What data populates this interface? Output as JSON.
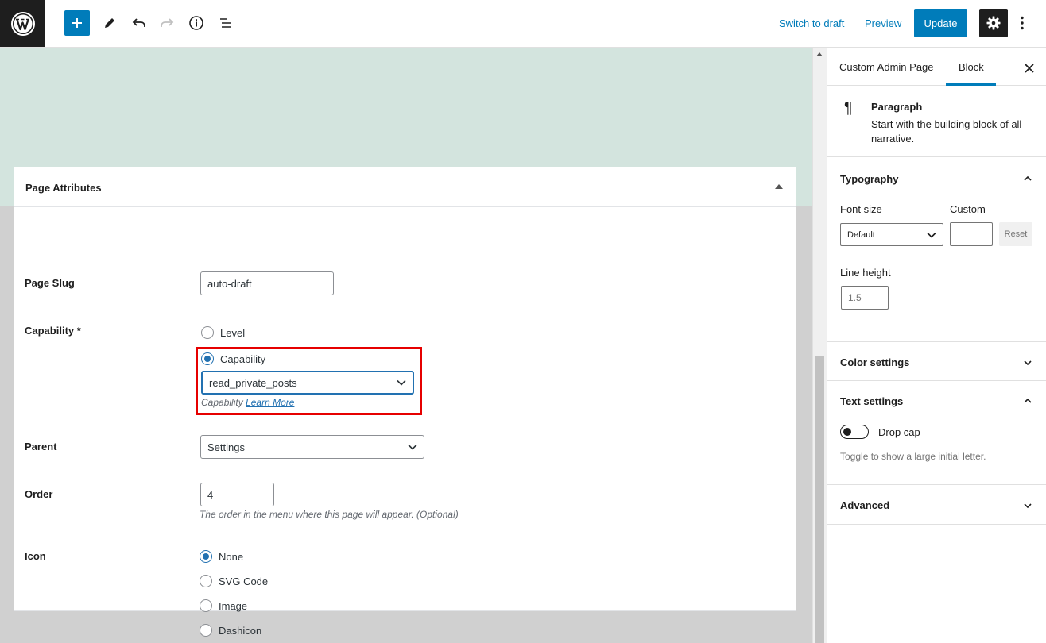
{
  "toolbar": {
    "switch_to_draft": "Switch to draft",
    "preview": "Preview",
    "update": "Update"
  },
  "metabox": {
    "title": "Page Attributes",
    "page_slug": {
      "label": "Page Slug",
      "value": "auto-draft"
    },
    "capability": {
      "label": "Capability *",
      "options": [
        "Level",
        "Capability"
      ],
      "selected": "Capability",
      "select_value": "read_private_posts",
      "hint_text": "Capability",
      "hint_link": "Learn More"
    },
    "parent": {
      "label": "Parent",
      "value": "Settings"
    },
    "order": {
      "label": "Order",
      "value": "4",
      "hint": "The order in the menu where this page will appear. (Optional)"
    },
    "icon": {
      "label": "Icon",
      "options": [
        "None",
        "SVG Code",
        "Image",
        "Dashicon"
      ],
      "selected": "None"
    }
  },
  "sidebar": {
    "tabs": [
      "Custom Admin Page",
      "Block"
    ],
    "active_tab": "Block",
    "block": {
      "title": "Paragraph",
      "description": "Start with the building block of all narrative."
    },
    "typography": {
      "title": "Typography",
      "font_size_label": "Font size",
      "custom_label": "Custom",
      "font_size_value": "Default",
      "reset": "Reset",
      "line_height_label": "Line height",
      "line_height_placeholder": "1.5"
    },
    "color_settings": "Color settings",
    "text_settings": {
      "title": "Text settings",
      "drop_cap": "Drop cap",
      "help": "Toggle to show a large initial letter."
    },
    "advanced": "Advanced"
  },
  "colors": {
    "accent": "#007cba",
    "canvas": "#d3e4de",
    "highlight": "#e60000"
  }
}
